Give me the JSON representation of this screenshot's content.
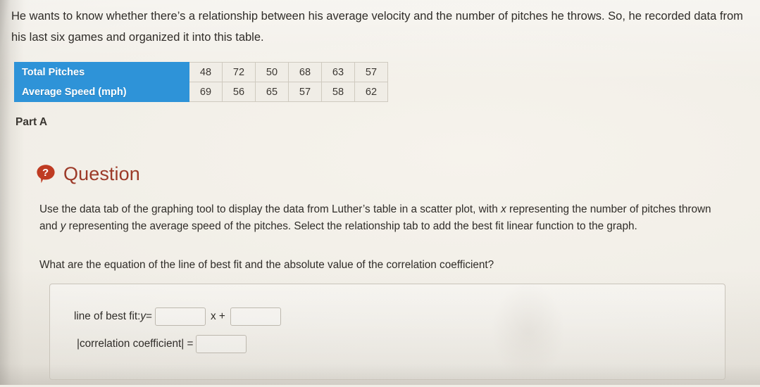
{
  "intro": {
    "line1": "He wants to know whether there’s a relationship between his average velocity and the number of pitches he throws. So, he",
    "line2": "recorded data from his last six games and organized it into this table."
  },
  "table": {
    "rows": [
      {
        "label": "Total Pitches",
        "values": [
          "48",
          "72",
          "50",
          "68",
          "63",
          "57"
        ]
      },
      {
        "label": "Average Speed (mph)",
        "values": [
          "69",
          "56",
          "65",
          "57",
          "58",
          "62"
        ]
      }
    ],
    "header_color": "#2e93d8"
  },
  "part": {
    "label": "Part A"
  },
  "question": {
    "icon": "question-bubble-icon",
    "title": "Question",
    "title_color": "#9c3a28",
    "body_pre": "Use the data tab of the graphing tool to display the data from Luther’s table in a scatter plot, with ",
    "body_var_x": "x",
    "body_mid": " representing the number of pitches thrown and ",
    "body_var_y": "y",
    "body_post": " representing the average speed of the pitches. Select the relationship tab to add the best fit linear function to the graph.",
    "ask": "What are the equation of the line of best fit and the absolute value of the correlation coefficient?"
  },
  "answer": {
    "line_label": "line of best fit: ",
    "line_var_y": "y",
    "equals": " = ",
    "x_plus": "x +",
    "slope_value": "",
    "intercept_value": "",
    "corr_label": "|correlation coefficient| =",
    "corr_value": ""
  }
}
